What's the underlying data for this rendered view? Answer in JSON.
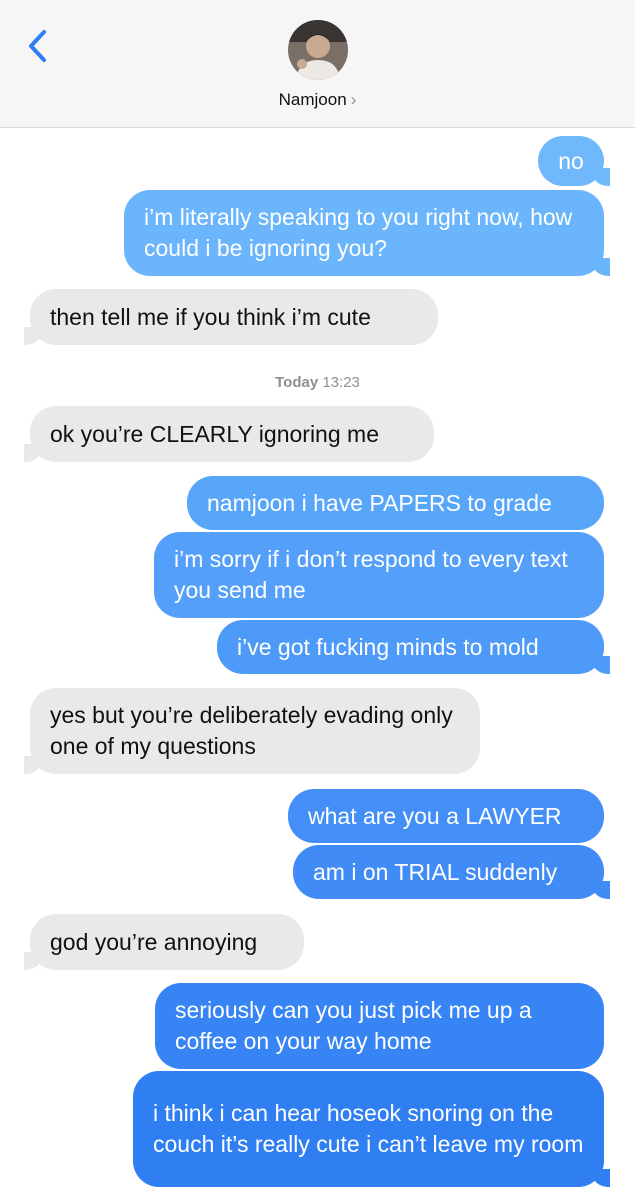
{
  "header": {
    "contact_name": "Namjoon",
    "chevron": "›",
    "back_icon": "chevron-left-icon"
  },
  "thread": {
    "messages": [
      {
        "from": "me",
        "text": "no"
      },
      {
        "from": "me",
        "text": "i’m literally speaking to you right now, how could i be ignoring you?"
      },
      {
        "from": "them",
        "text": "then tell me if you think i’m cute"
      },
      {
        "from": "them",
        "text": "ok you’re CLEARLY ignoring me"
      },
      {
        "from": "me",
        "text": "namjoon i have PAPERS to grade"
      },
      {
        "from": "me",
        "text": "i’m sorry if i don’t respond to every text you send me"
      },
      {
        "from": "me",
        "text": "i’ve got fucking minds to mold"
      },
      {
        "from": "them",
        "text": "yes but you’re deliberately evading only one of my questions"
      },
      {
        "from": "me",
        "text": "what are you a LAWYER"
      },
      {
        "from": "me",
        "text": "am i on TRIAL suddenly"
      },
      {
        "from": "them",
        "text": "god you’re annoying"
      },
      {
        "from": "me",
        "text": "seriously can you just pick me up a coffee on your way home"
      },
      {
        "from": "me",
        "text": "i think i can hear hoseok snoring on the couch it’s really cute i can’t leave my room"
      }
    ],
    "timestamp": {
      "day": "Today",
      "time": "13:23"
    }
  },
  "colors": {
    "outgoing_top": "#6fb7fb",
    "outgoing_bottom": "#2f7ff3",
    "incoming": "#e9e9eb",
    "accent": "#2f7ff3"
  }
}
